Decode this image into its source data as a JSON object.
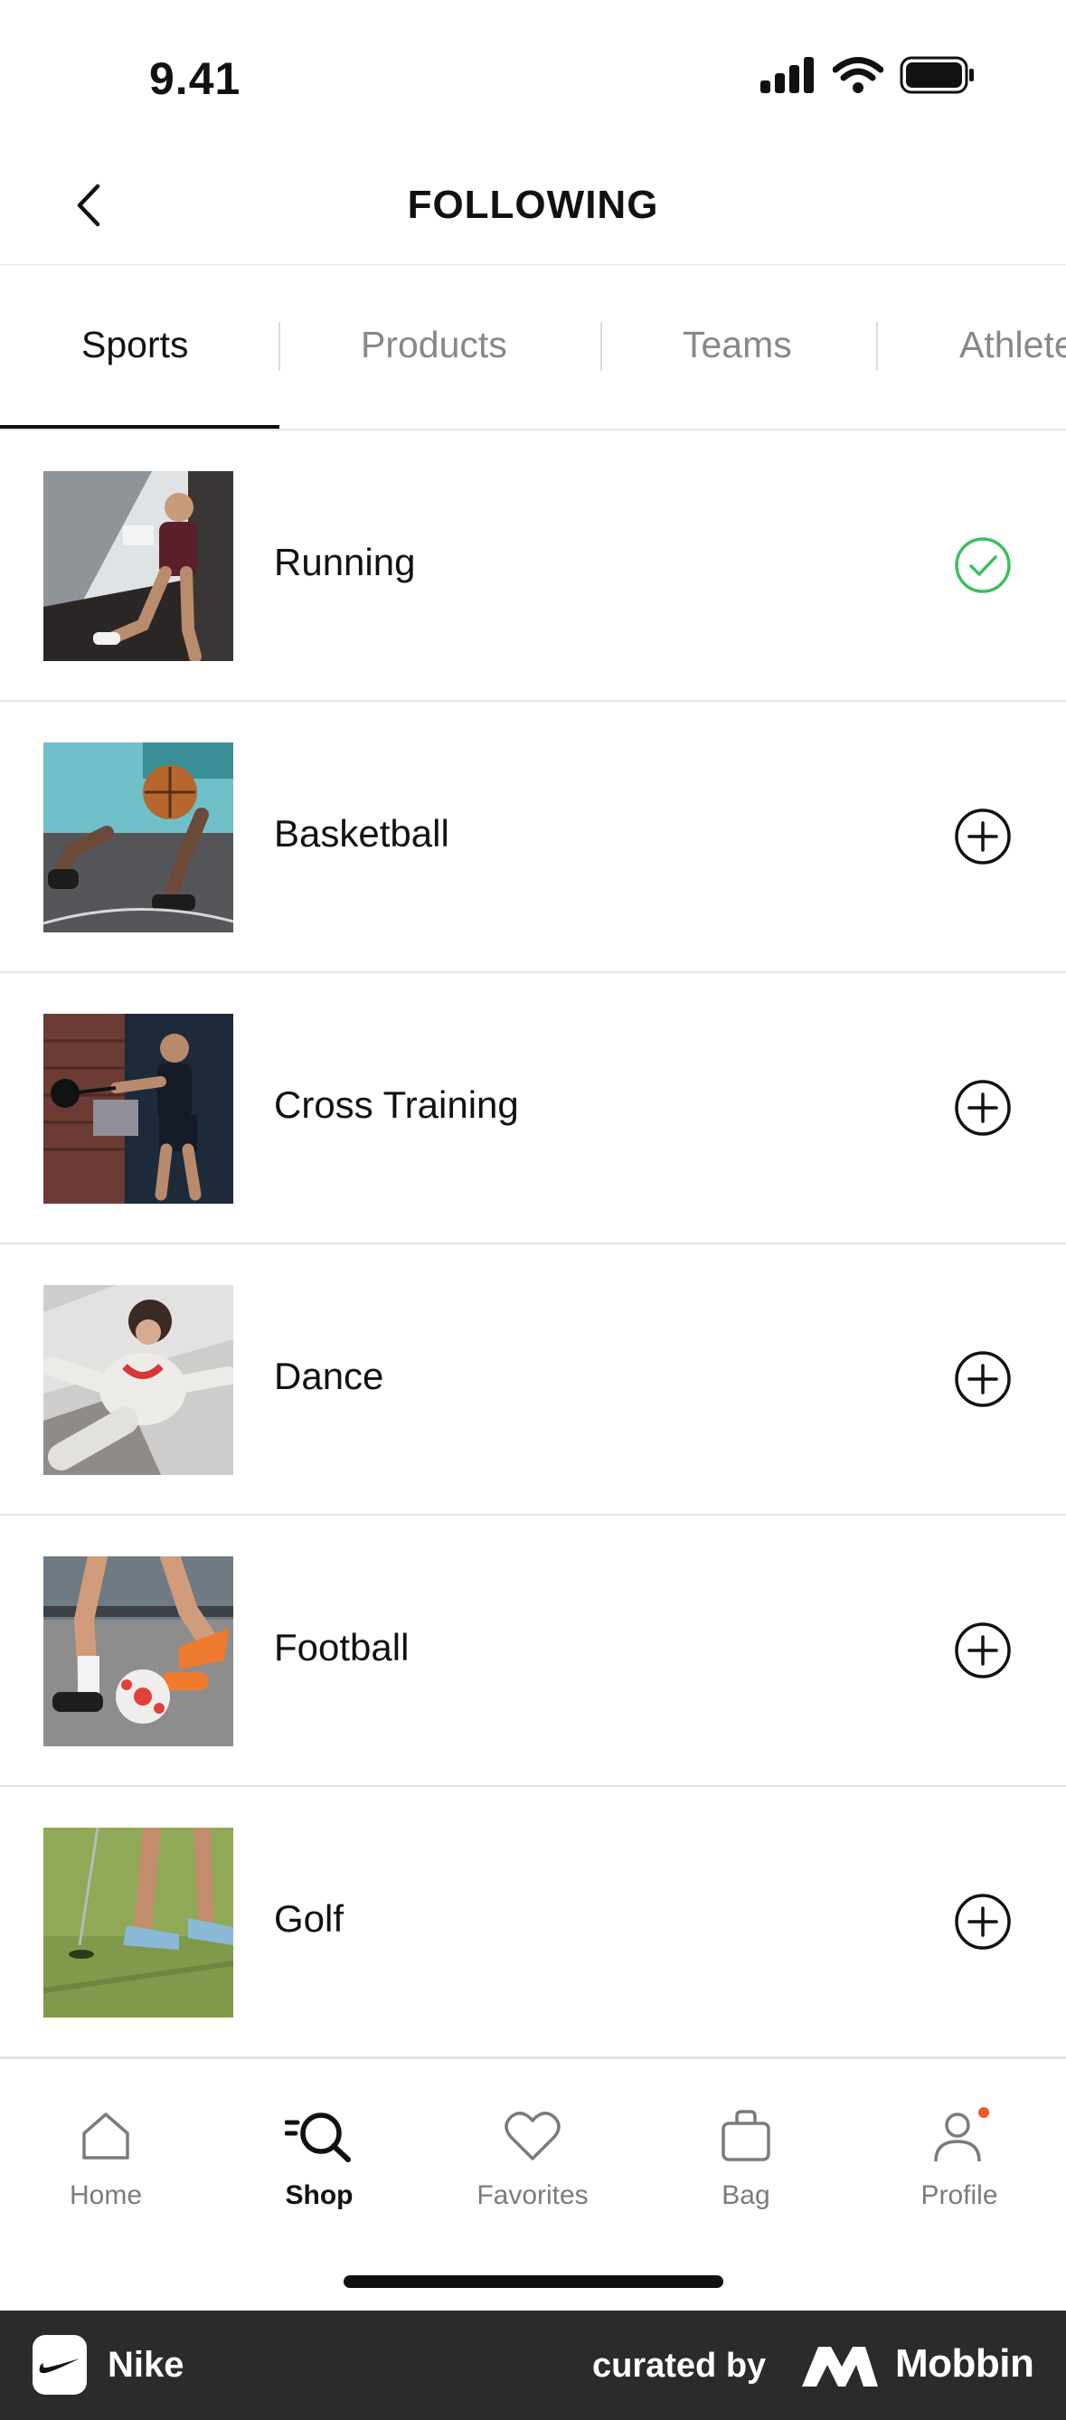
{
  "status_bar": {
    "time": "9.41"
  },
  "header": {
    "title": "FOLLOWING"
  },
  "tabs": [
    {
      "label": "Sports",
      "active": true
    },
    {
      "label": "Products",
      "active": false
    },
    {
      "label": "Teams",
      "active": false
    },
    {
      "label": "Athlete",
      "active": false
    }
  ],
  "sports": [
    {
      "label": "Running",
      "followed": true,
      "action_icon": "check-circle-icon"
    },
    {
      "label": "Basketball",
      "followed": false,
      "action_icon": "plus-circle-icon"
    },
    {
      "label": "Cross Training",
      "followed": false,
      "action_icon": "plus-circle-icon"
    },
    {
      "label": "Dance",
      "followed": false,
      "action_icon": "plus-circle-icon"
    },
    {
      "label": "Football",
      "followed": false,
      "action_icon": "plus-circle-icon"
    },
    {
      "label": "Golf",
      "followed": false,
      "action_icon": "plus-circle-icon"
    }
  ],
  "bottom_nav": [
    {
      "label": "Home",
      "icon": "home-icon",
      "active": false
    },
    {
      "label": "Shop",
      "icon": "search-icon",
      "active": true
    },
    {
      "label": "Favorites",
      "icon": "heart-icon",
      "active": false
    },
    {
      "label": "Bag",
      "icon": "bag-icon",
      "active": false
    },
    {
      "label": "Profile",
      "icon": "profile-icon",
      "active": false,
      "badge": true
    }
  ],
  "footer": {
    "app_name": "Nike",
    "curated_by": "curated by",
    "brand": "Mobbin"
  },
  "colors": {
    "followed_green": "#3fbf5f",
    "badge_orange": "#f05a28",
    "text_primary": "#111111",
    "text_muted": "#888888"
  }
}
